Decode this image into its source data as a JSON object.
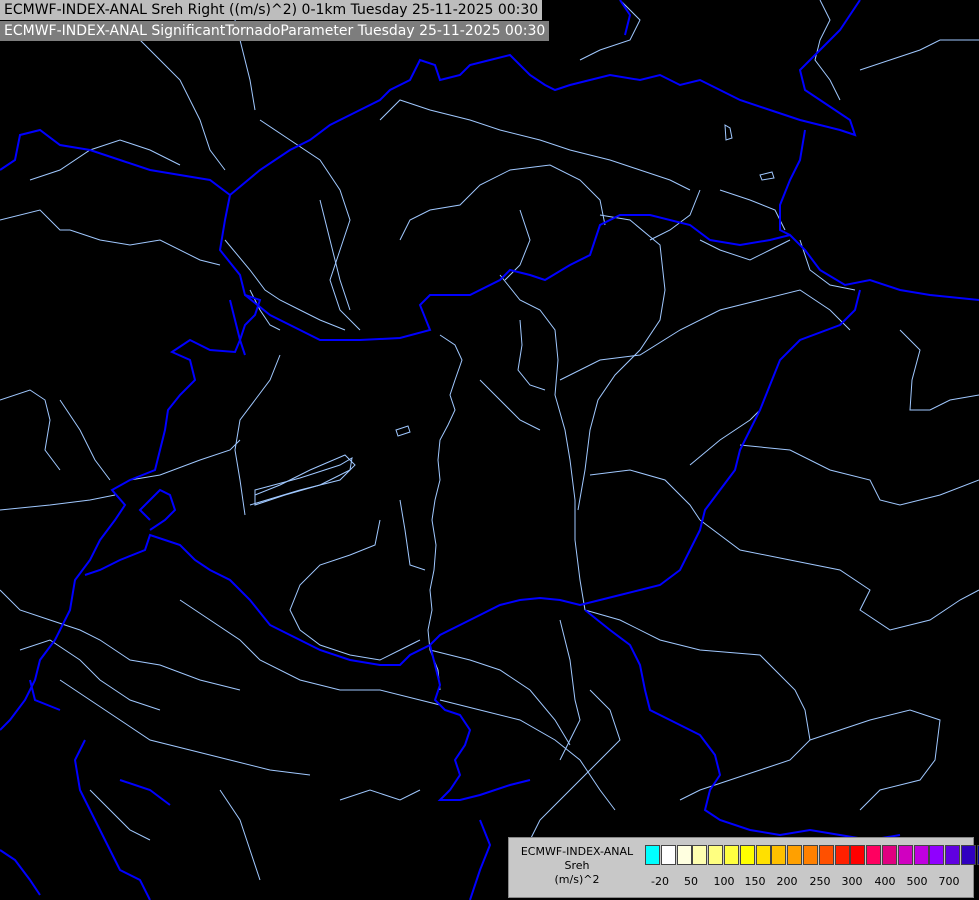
{
  "header": {
    "line1": "ECMWF-INDEX-ANAL Sreh Right ((m/s)^2) 0-1km Tuesday 25-11-2025 00:30",
    "line2": "ECMWF-INDEX-ANAL SignificantTornadoParameter Tuesday 25-11-2025 00:30"
  },
  "colors": {
    "background": "#000000",
    "borders": "#0000ff",
    "rivers": "#a0c8ff"
  },
  "legend": {
    "line1": "ECMWF-INDEX-ANAL",
    "line2": "Sreh",
    "line3": "(m/s)^2",
    "colors": [
      "#00ffff",
      "#ffffff",
      "#ffffe0",
      "#ffffb0",
      "#ffff80",
      "#ffff40",
      "#ffff00",
      "#ffe000",
      "#ffc000",
      "#ffa000",
      "#ff8000",
      "#ff5000",
      "#ff2000",
      "#ff0000",
      "#ff0060",
      "#e00080",
      "#d000c0",
      "#c000e0",
      "#9000ff",
      "#6000e0",
      "#3000c0",
      "#000090"
    ],
    "ticks": [
      "-20",
      "50",
      "100",
      "150",
      "200",
      "250",
      "300",
      "400",
      "500",
      "700"
    ]
  }
}
